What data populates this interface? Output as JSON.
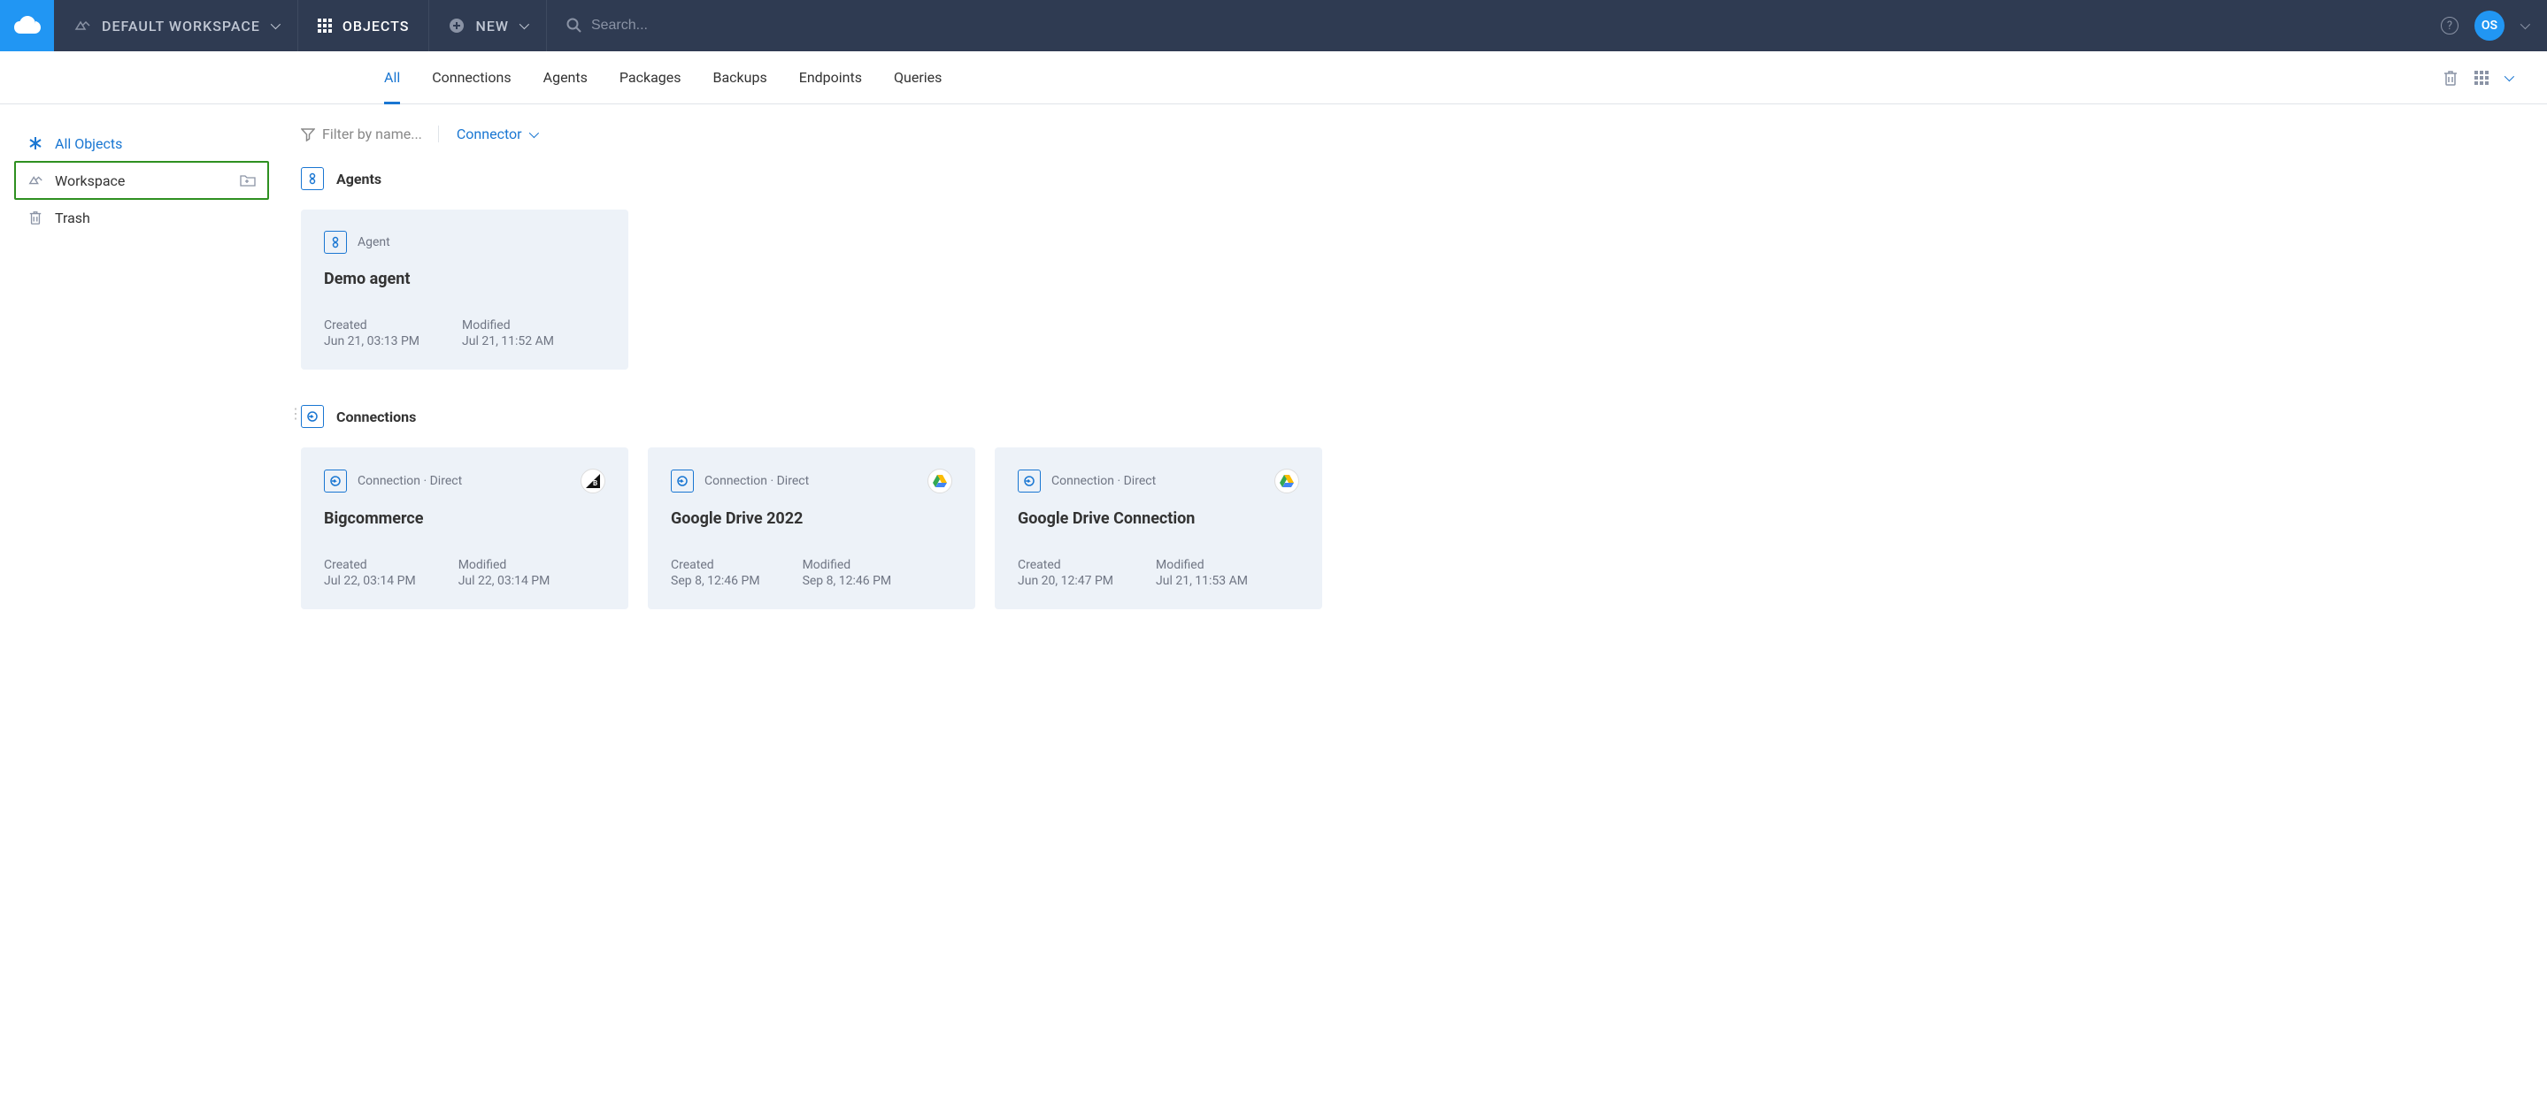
{
  "topbar": {
    "workspace_label": "DEFAULT WORKSPACE",
    "objects_label": "OBJECTS",
    "new_label": "NEW",
    "search_placeholder": "Search...",
    "help_glyph": "?",
    "avatar_initials": "OS"
  },
  "tabs": {
    "all": "All",
    "connections": "Connections",
    "agents": "Agents",
    "packages": "Packages",
    "backups": "Backups",
    "endpoints": "Endpoints",
    "queries": "Queries"
  },
  "sidebar": {
    "all_objects": "All Objects",
    "workspace": "Workspace",
    "trash": "Trash"
  },
  "filters": {
    "placeholder": "Filter by name...",
    "connector_label": "Connector"
  },
  "sections": {
    "agents": {
      "title": "Agents"
    },
    "connections": {
      "title": "Connections"
    }
  },
  "agent_cards": [
    {
      "type_label": "Agent",
      "title": "Demo agent",
      "created_label": "Created",
      "created_value": "Jun 21, 03:13 PM",
      "modified_label": "Modified",
      "modified_value": "Jul 21, 11:52 AM"
    }
  ],
  "connection_cards": [
    {
      "type_label": "Connection · Direct",
      "title": "Bigcommerce",
      "logo": "bigcommerce",
      "created_label": "Created",
      "created_value": "Jul 22, 03:14 PM",
      "modified_label": "Modified",
      "modified_value": "Jul 22, 03:14 PM"
    },
    {
      "type_label": "Connection · Direct",
      "title": "Google Drive 2022",
      "logo": "gdrive",
      "created_label": "Created",
      "created_value": "Sep 8, 12:46 PM",
      "modified_label": "Modified",
      "modified_value": "Sep 8, 12:46 PM"
    },
    {
      "type_label": "Connection · Direct",
      "title": "Google Drive Connection",
      "logo": "gdrive",
      "created_label": "Created",
      "created_value": "Jun 20, 12:47 PM",
      "modified_label": "Modified",
      "modified_value": "Jul 21, 11:53 AM"
    }
  ]
}
